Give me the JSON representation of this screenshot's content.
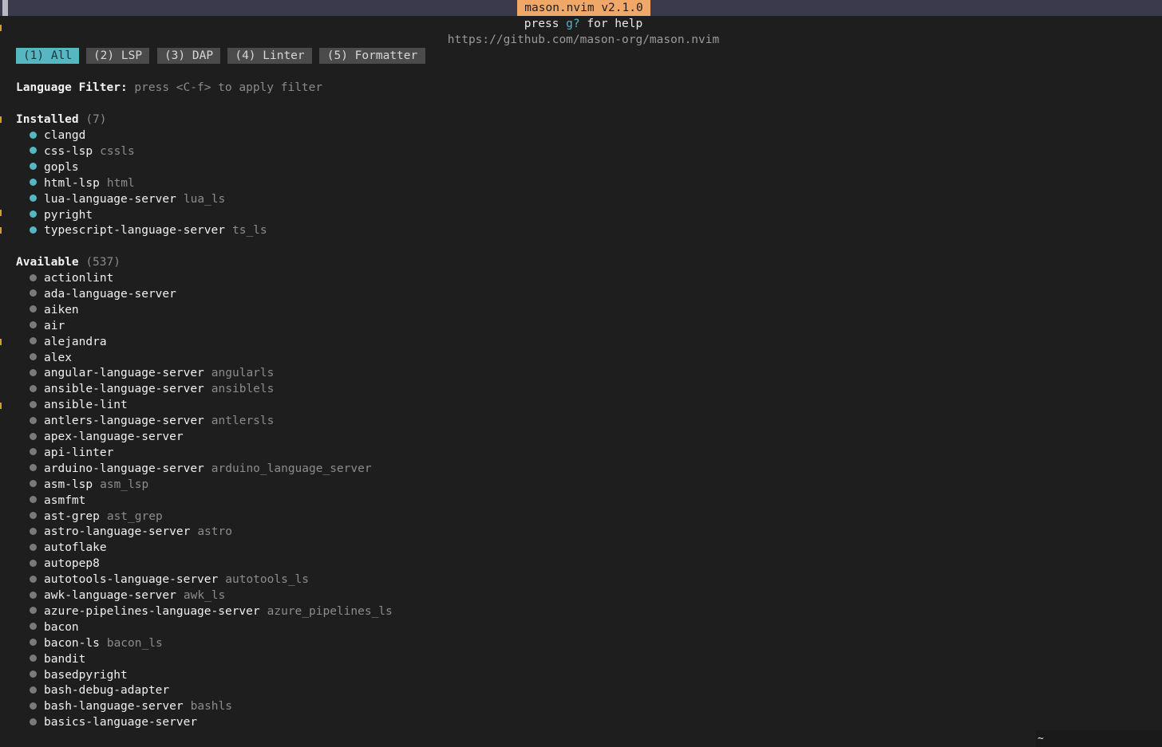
{
  "header": {
    "title": "mason.nvim v2.1.0",
    "help_prefix": "press ",
    "help_key": "g?",
    "help_suffix": " for help",
    "url": "https://github.com/mason-org/mason.nvim"
  },
  "tabs": [
    {
      "label": "(1) All",
      "active": true
    },
    {
      "label": "(2) LSP",
      "active": false
    },
    {
      "label": "(3) DAP",
      "active": false
    },
    {
      "label": "(4) Linter",
      "active": false
    },
    {
      "label": "(5) Formatter",
      "active": false
    }
  ],
  "filter": {
    "label": "Language Filter:",
    "hint": "press <C-f> to apply filter"
  },
  "installed": {
    "heading": "Installed",
    "count": "(7)",
    "items": [
      {
        "name": "clangd",
        "alias": ""
      },
      {
        "name": "css-lsp",
        "alias": "cssls"
      },
      {
        "name": "gopls",
        "alias": ""
      },
      {
        "name": "html-lsp",
        "alias": "html"
      },
      {
        "name": "lua-language-server",
        "alias": "lua_ls"
      },
      {
        "name": "pyright",
        "alias": ""
      },
      {
        "name": "typescript-language-server",
        "alias": "ts_ls"
      }
    ]
  },
  "available": {
    "heading": "Available",
    "count": "(537)",
    "items": [
      {
        "name": "actionlint",
        "alias": ""
      },
      {
        "name": "ada-language-server",
        "alias": ""
      },
      {
        "name": "aiken",
        "alias": ""
      },
      {
        "name": "air",
        "alias": ""
      },
      {
        "name": "alejandra",
        "alias": ""
      },
      {
        "name": "alex",
        "alias": ""
      },
      {
        "name": "angular-language-server",
        "alias": "angularls"
      },
      {
        "name": "ansible-language-server",
        "alias": "ansiblels"
      },
      {
        "name": "ansible-lint",
        "alias": ""
      },
      {
        "name": "antlers-language-server",
        "alias": "antlersls"
      },
      {
        "name": "apex-language-server",
        "alias": ""
      },
      {
        "name": "api-linter",
        "alias": ""
      },
      {
        "name": "arduino-language-server",
        "alias": "arduino_language_server"
      },
      {
        "name": "asm-lsp",
        "alias": "asm_lsp"
      },
      {
        "name": "asmfmt",
        "alias": ""
      },
      {
        "name": "ast-grep",
        "alias": "ast_grep"
      },
      {
        "name": "astro-language-server",
        "alias": "astro"
      },
      {
        "name": "autoflake",
        "alias": ""
      },
      {
        "name": "autopep8",
        "alias": ""
      },
      {
        "name": "autotools-language-server",
        "alias": "autotools_ls"
      },
      {
        "name": "awk-language-server",
        "alias": "awk_ls"
      },
      {
        "name": "azure-pipelines-language-server",
        "alias": "azure_pipelines_ls"
      },
      {
        "name": "bacon",
        "alias": ""
      },
      {
        "name": "bacon-ls",
        "alias": "bacon_ls"
      },
      {
        "name": "bandit",
        "alias": ""
      },
      {
        "name": "basedpyright",
        "alias": ""
      },
      {
        "name": "bash-debug-adapter",
        "alias": ""
      },
      {
        "name": "bash-language-server",
        "alias": "bashls"
      },
      {
        "name": "basics-language-server",
        "alias": ""
      }
    ]
  },
  "status": {
    "tilde": "~"
  },
  "colors": {
    "background": "#1e1e1e",
    "accent": "#56b6c2",
    "title_bg": "#f0a868",
    "tab_bg": "#4b4b4b"
  }
}
